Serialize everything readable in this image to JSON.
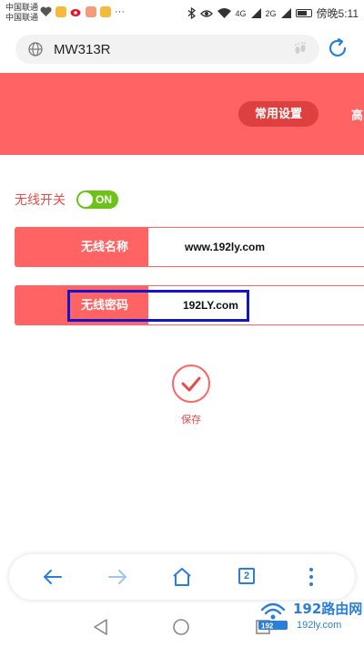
{
  "status_bar": {
    "carrier_1": "中国联通",
    "carrier_2": "中国联通",
    "dots": "···",
    "signal_1": "4G",
    "signal_2": "2G",
    "time": "傍晚5:11"
  },
  "browser": {
    "url": "MW313R"
  },
  "header": {
    "tab_common": "常用设置",
    "tab_advanced": "高"
  },
  "wifi": {
    "switch_label": "无线开关",
    "switch_state": "ON",
    "ssid_label": "无线名称",
    "ssid_value": "www.192ly.com",
    "password_label": "无线密码",
    "password_value": "192LY.com"
  },
  "save": {
    "label": "保存"
  },
  "toolbar": {
    "tab_count": "2"
  },
  "watermark": {
    "text_big": "192路由网",
    "text_small": "192ly.com",
    "prefix": "192"
  },
  "colors": {
    "brand_red": "#ff6363",
    "dark_red": "#de3f3f",
    "toggle_green": "#6dc218",
    "browser_blue": "#2a7fd8",
    "highlight_blue": "#1414c8"
  }
}
